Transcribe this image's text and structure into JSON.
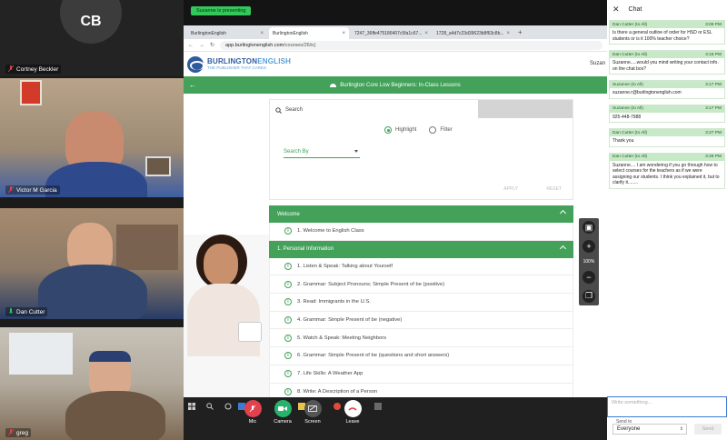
{
  "participants": [
    {
      "initials": "CB",
      "name": "Cortney Beckler",
      "muted": true
    },
    {
      "name": "Victor M Garcia",
      "muted": true
    },
    {
      "name": "Dan Cutter",
      "muted": false
    },
    {
      "name": "greg",
      "muted": true
    }
  ],
  "presenting_label": "Suzanne is presenting",
  "browser": {
    "tabs": [
      {
        "label": "BurlingtonEnglish"
      },
      {
        "label": "BurlingtonEnglish"
      },
      {
        "label": "7247_36ffe475186407c5fa1c67..."
      },
      {
        "label": "1728_a4d7c23d39623b8f63c8b..."
      }
    ],
    "url_host": "app.burlingtonenglish.com",
    "url_path": "/courses/26/ic|",
    "brand": "BURLINGTON",
    "brand_suffix": "ENGLISH",
    "tagline": "THE PUBLISHER THAT CARES",
    "user_name": "Suzan",
    "page_title": "Burlington Core Low Beginners: In-Class Lessons"
  },
  "search": {
    "label": "Search",
    "highlight": "Highlight",
    "filter": "Filter",
    "search_by": "Search By",
    "apply": "APPLY",
    "reset": "RESET"
  },
  "zoom": "100%",
  "sections": [
    {
      "title": "Welcome",
      "items": [
        "1. Welcome to English Class"
      ]
    },
    {
      "title": "1. Personal Information",
      "items": [
        "1. Listen & Speak: Talking about Yourself",
        "2. Grammar: Subject Pronouns; Simple Present of be (positive)",
        "3. Read: Immigrants in the U.S.",
        "4. Grammar: Simple Present of be (negative)",
        "5. Watch & Speak: Meeting Neighbors",
        "6. Grammar: Simple Present of be (questions and short answers)",
        "7. Life Skills: A Weather App",
        "8. Write: A Description of a Person"
      ]
    }
  ],
  "meeting_controls": [
    {
      "label": "Mic",
      "color": "#e0424e"
    },
    {
      "label": "Camera",
      "color": "#27b36c"
    },
    {
      "label": "Screen",
      "color": "#555555"
    },
    {
      "label": "Leave",
      "color": "#ffffff"
    }
  ],
  "chat": {
    "title": "Chat",
    "messages": [
      {
        "from": "Dan Cutter (to All)",
        "time": "3:09 PM",
        "text": "Is there a general outline of order for HSD or ESL students or is it 100% teacher choice?"
      },
      {
        "from": "Dan Cutter (to All)",
        "time": "3:16 PM",
        "text": "Suzanne.....would you mind writing your contact info. on the chat box?"
      },
      {
        "from": "Suzanne (to All)",
        "time": "3:17 PM",
        "text": "suzanne.r@burlingtonenglish.com"
      },
      {
        "from": "Suzanne (to All)",
        "time": "3:17 PM",
        "text": "925-448-7988"
      },
      {
        "from": "Dan Cutter (to All)",
        "time": "3:27 PM",
        "text": "Thank you"
      },
      {
        "from": "Dan Cutter (to All)",
        "time": "3:28 PM",
        "text": "Suzanne.... I am wondering if you go through how to select courses for the teachers as if we were assigning our students. I think you explained it, but to clarify it........"
      }
    ],
    "input_placeholder": "Write something...",
    "send_to_label": "Send to",
    "send_to_value": "Everyone",
    "send_label": "Send"
  }
}
